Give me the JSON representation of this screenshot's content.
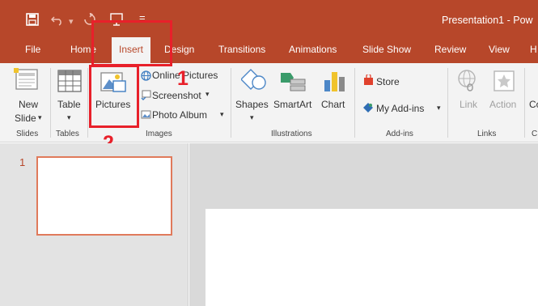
{
  "titlebar": {
    "save_icon": "save-icon",
    "undo_icon": "undo-icon",
    "redo_icon": "redo-icon",
    "customize_icon": "customize-qat-icon",
    "doc_title": "Presentation1 - Pow"
  },
  "tabs": [
    "File",
    "Home",
    "Insert",
    "Design",
    "Transitions",
    "Animations",
    "Slide Show",
    "Review",
    "View",
    "H"
  ],
  "active_tab": "Insert",
  "ribbon": {
    "slides": {
      "new_slide_line1": "New",
      "new_slide_line2": "Slide",
      "dropdown": "▾",
      "group_label": "Slides"
    },
    "tables": {
      "table": "Table",
      "dropdown": "▾",
      "group_label": "Tables"
    },
    "images": {
      "pictures": "Pictures",
      "online_pictures": "Online Pictures",
      "screenshot": "Screenshot",
      "photo_album": "Photo Album",
      "dropdown": "▾",
      "group_label": "Images"
    },
    "illustrations": {
      "shapes": "Shapes",
      "smartart": "SmartArt",
      "chart": "Chart",
      "dropdown": "▾",
      "group_label": "Illustrations"
    },
    "addins": {
      "store": "Store",
      "my_addins": "My Add-ins",
      "dropdown": "▾",
      "group_label": "Add-ins"
    },
    "links": {
      "link": "Link",
      "action": "Action",
      "group_label": "Links"
    },
    "cut_off": {
      "label": "Co",
      "group_label": "C"
    }
  },
  "annotations": {
    "step1": "1",
    "step2": "2"
  },
  "thumbnails": {
    "slide_number": "1"
  },
  "colors": {
    "accent": "#b7472a",
    "highlight": "#e8202a",
    "ribbon_bg": "#f3f3f3"
  }
}
